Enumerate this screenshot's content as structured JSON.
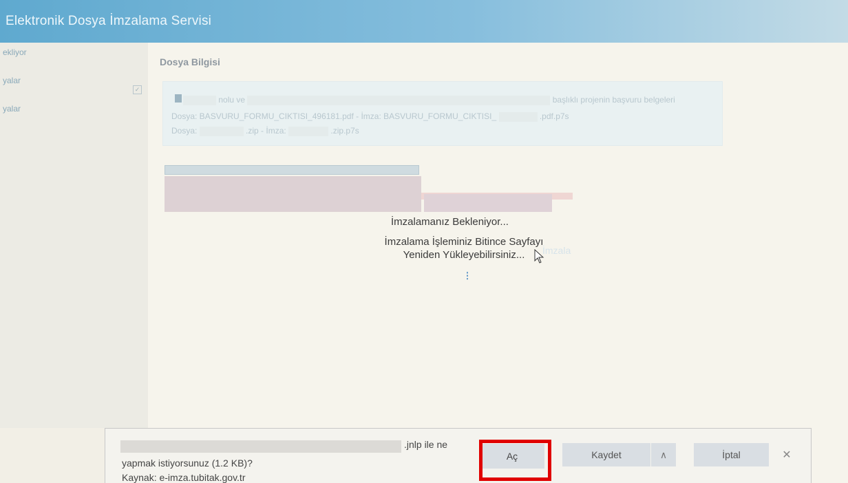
{
  "header": {
    "title": "Elektronik Dosya İmzalama Servisi"
  },
  "sidebar": {
    "items": [
      {
        "label": "ekliyor"
      },
      {
        "label": "yalar"
      },
      {
        "label": "yalar"
      }
    ]
  },
  "main": {
    "section_title": "Dosya Bilgisi",
    "info": {
      "line1_mid": "nolu ve",
      "line1_end": "başlıklı projenin başvuru belgeleri",
      "line2": "Dosya: BASVURU_FORMU_CIKTISI_496181.pdf - İmza: BASVURU_FORMU_CIKTISI_",
      "line2_end": ".pdf.p7s",
      "line3_a": "Dosya:",
      "line3_b": ".zip - İmza:",
      "line3_c": ".zip.p7s"
    },
    "waiting": {
      "line1": "İmzalamanız Bekleniyor...",
      "line2": "İmzalama İşleminiz Bitince Sayfayı Yeniden Yükleyebilirsiniz...",
      "ghost_text": "İmzala"
    }
  },
  "download_bar": {
    "file_ext_text": ".jnlp ile ne",
    "question": "yapmak istiyorsunuz (1.2 KB)?",
    "source": "Kaynak: e-imza.tubitak.gov.tr",
    "open_label": "Aç",
    "save_label": "Kaydet",
    "more_label": "∧",
    "cancel_label": "İptal",
    "close_label": "✕"
  },
  "colors": {
    "header": "#5fa9cf",
    "highlight": "#e00000"
  }
}
